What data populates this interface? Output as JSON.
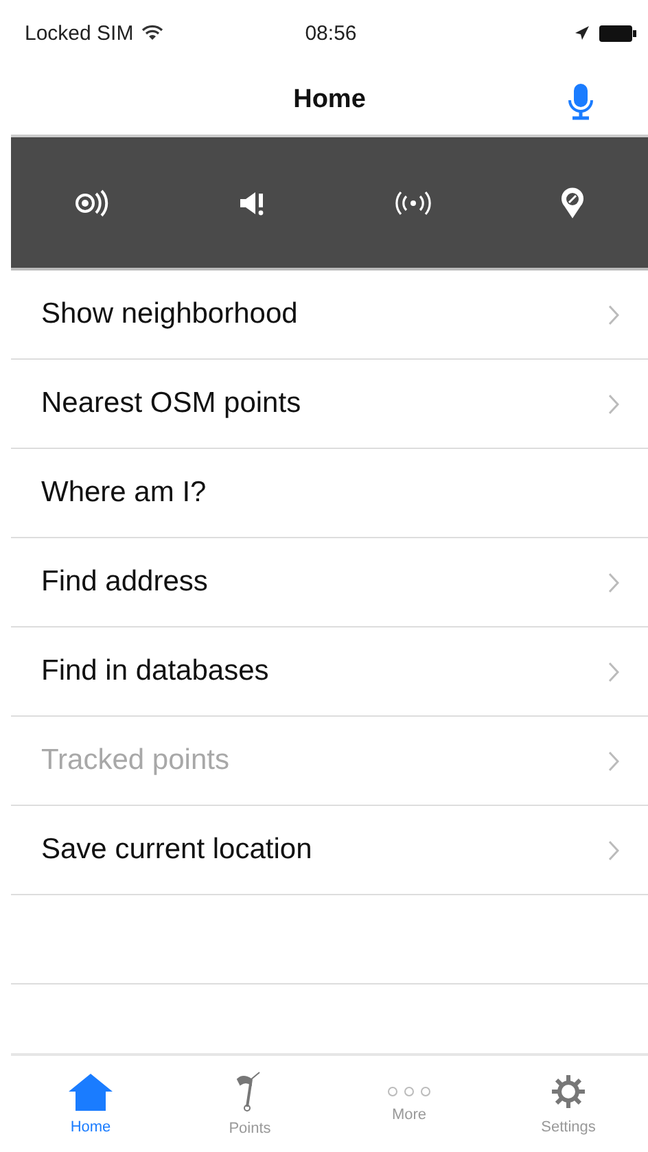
{
  "status_bar": {
    "carrier": "Locked SIM",
    "time": "08:56"
  },
  "nav": {
    "title": "Home"
  },
  "toolbar": [
    {
      "kind": "radar"
    },
    {
      "kind": "speaker"
    },
    {
      "kind": "broadcast"
    },
    {
      "kind": "pin"
    }
  ],
  "menu": [
    {
      "label": "Show neighborhood",
      "disabled": false,
      "disclosure": true
    },
    {
      "label": "Nearest OSM points",
      "disabled": false,
      "disclosure": true
    },
    {
      "label": "Where am I?",
      "disabled": false,
      "disclosure": false
    },
    {
      "label": "Find address",
      "disabled": false,
      "disclosure": true
    },
    {
      "label": "Find in databases",
      "disabled": false,
      "disclosure": true
    },
    {
      "label": "Tracked points",
      "disabled": true,
      "disclosure": true
    },
    {
      "label": "Save current location",
      "disabled": false,
      "disclosure": true
    }
  ],
  "tabs": [
    {
      "label": "Home",
      "kind": "home",
      "selected": true
    },
    {
      "label": "Points",
      "kind": "flag",
      "selected": false
    },
    {
      "label": "More",
      "kind": "more",
      "selected": false
    },
    {
      "label": "Settings",
      "kind": "gear",
      "selected": false
    }
  ]
}
